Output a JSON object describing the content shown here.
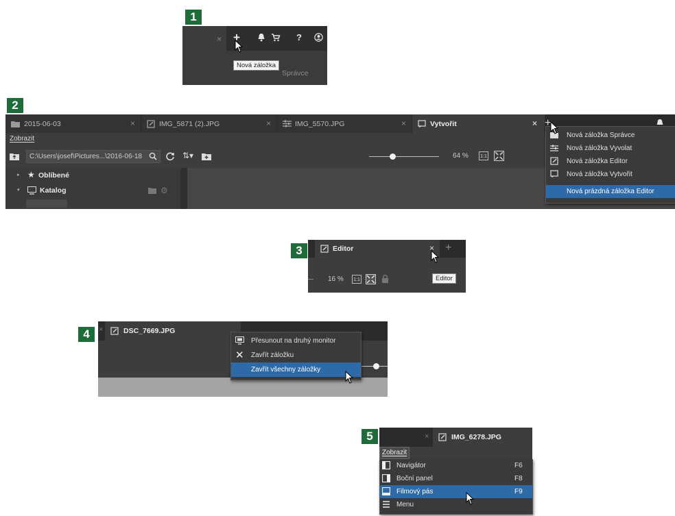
{
  "panels": {
    "p1": {
      "badge": "1",
      "tab_close": "×",
      "new_tab_icon": "+",
      "tooltip": "Nová záložka",
      "caption": "Správce",
      "icons": [
        "bell-icon",
        "cart-icon",
        "help-icon",
        "user-icon"
      ]
    },
    "p2": {
      "badge": "2",
      "tabs": [
        {
          "label": "2015-06-03",
          "icon": "folder-icon"
        },
        {
          "label": "IMG_5871 (2).JPG",
          "icon": "edit-icon"
        },
        {
          "label": "IMG_5570.JPG",
          "icon": "develop-icon"
        },
        {
          "label": "Vytvořit",
          "icon": "create-icon"
        }
      ],
      "menu_label": "Zobrazit",
      "path": "C:\\Users\\josef\\Pictures...\\2016-06-18",
      "zoom": "64 %",
      "zoom_fit_1to1": "1:1",
      "sidebar": {
        "favorites": "Oblíbené",
        "catalog": "Katalog"
      },
      "dropdown": [
        {
          "label": "Nová záložka Správce",
          "icon": "folder-icon"
        },
        {
          "label": "Nová záložka Vyvolat",
          "icon": "develop-icon"
        },
        {
          "label": "Nová záložka Editor",
          "icon": "edit-icon"
        },
        {
          "label": "Nová záložka Vytvořit",
          "icon": "create-icon"
        },
        {
          "label": "Nová prázdná záložka Editor",
          "icon": "",
          "highlighted": true
        }
      ]
    },
    "p3": {
      "badge": "3",
      "tab_label": "Editor",
      "new_tab_icon": "+",
      "tab_close": "×",
      "zoom": "16 %",
      "zoom_1to1": "1:1",
      "tooltip": "Editor"
    },
    "p4": {
      "badge": "4",
      "tab_label": "DSC_7669.JPG",
      "context_menu": [
        {
          "label": "Přesunout na druhý monitor",
          "icon": "monitor-icon"
        },
        {
          "label": "Zavřít záložku",
          "icon": "close-icon"
        },
        {
          "label": "Zavřít všechny záložky",
          "icon": "",
          "highlighted": true
        }
      ]
    },
    "p5": {
      "badge": "5",
      "tab_label": "IMG_6278.JPG",
      "menu_label": "Zobrazit",
      "menu": [
        {
          "label": "Navigátor",
          "shortcut": "F6",
          "icon": "navigator-icon"
        },
        {
          "label": "Boční panel",
          "shortcut": "F8",
          "icon": "side-panel-icon"
        },
        {
          "label": "Filmový pás",
          "shortcut": "F9",
          "icon": "filmstrip-icon",
          "highlighted": true
        },
        {
          "label": "Menu",
          "shortcut": "",
          "icon": "menu-icon"
        }
      ]
    }
  },
  "colors": {
    "badge_bg": "#1f6b3a",
    "highlight": "#2f6aa8",
    "panel_bg": "#3d3d3d",
    "tabbar_bg": "#2b2b2b"
  }
}
